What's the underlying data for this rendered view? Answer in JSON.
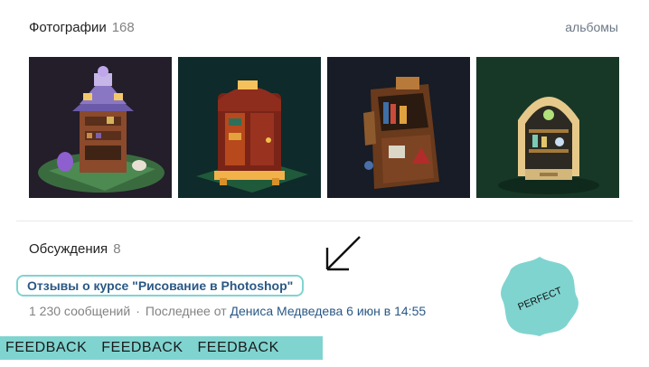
{
  "photos": {
    "title": "Фотографии",
    "count": "168",
    "albums_link": "альбомы",
    "items": [
      {
        "name": "purple-wizard-cabinet"
      },
      {
        "name": "red-wardrobe-cabinet"
      },
      {
        "name": "wooden-shelf-cabinet"
      },
      {
        "name": "green-arch-cabinet"
      }
    ]
  },
  "discussions": {
    "title": "Обсуждения",
    "count": "8",
    "topic": {
      "title": "Отзывы о курсе \"Рисование в Photoshop\"",
      "messages": "1 230 сообщений",
      "separator": "·",
      "last_from_label": "Последнее от",
      "last_author": "Дениса Медведева",
      "last_time": "6 июн в 14:55"
    }
  },
  "badge": {
    "text": "PERFECT",
    "color": "#7fd4d0"
  },
  "feedback_band": {
    "items": [
      "FEEDBACK",
      "FEEDBACK",
      "FEEDBACK"
    ],
    "color": "#7fd4d0"
  }
}
